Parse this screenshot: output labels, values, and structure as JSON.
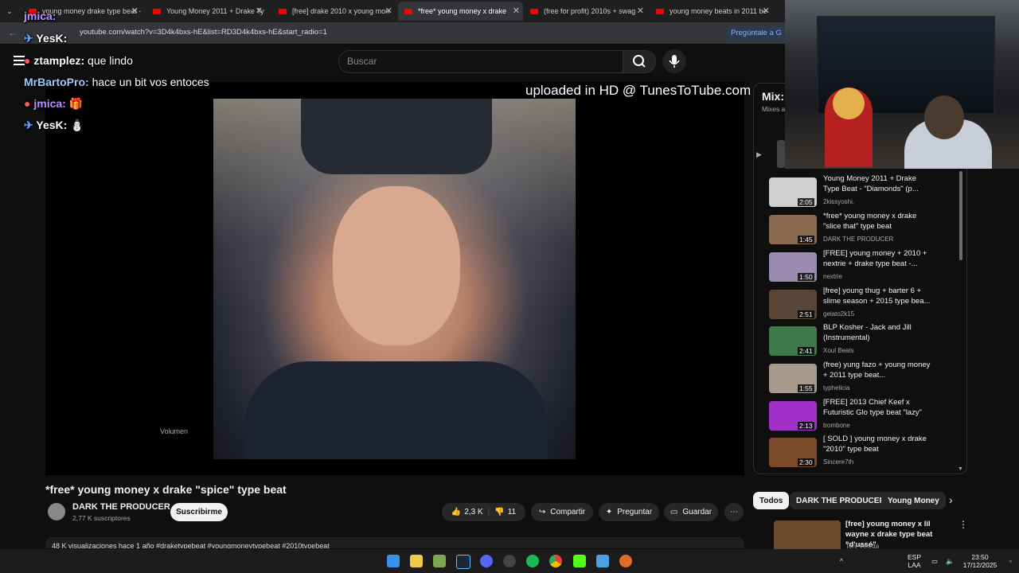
{
  "browser": {
    "tabs": [
      {
        "label": "young money drake type beat - Y"
      },
      {
        "label": "Young Money 2011 + Drake Ty"
      },
      {
        "label": "[free] drake 2010 x young mon"
      },
      {
        "label": "*free* young money x drake"
      },
      {
        "label": "(free for profit) 2010s + swag"
      },
      {
        "label": "young money beats in 2011 be"
      }
    ],
    "url": "youtube.com/watch?v=3D4k4bxs-hE&list=RD3D4k4bxs-hE&start_radio=1",
    "gemini": "Pregúntale a G"
  },
  "youtube": {
    "search_placeholder": "Buscar",
    "watermark": "uploaded in HD @ TunesToTube.com",
    "volume_label": "Volumen",
    "video_title": "*free* young money x drake \"spice\" type beat",
    "channel": "DARK THE PRODUCER",
    "subscribers": "2,77 K suscriptores",
    "subscribe": "Suscribirme",
    "likes": "2,3 K",
    "dislikes": "11",
    "share": "Compartir",
    "ask": "Preguntar",
    "save": "Guardar",
    "views_line": "48 K visualizaciones  hace 1 año  #draketypebeat #youngmoneytypebeat #2010typebeat",
    "mix_title": "Mix: *",
    "mix_sub": "Mixes ar",
    "playlist": [
      {
        "title": "Young Money 2011 + Drake Type Beat - \"Diamonds\" (p...",
        "channel": "2kissyoshi.",
        "duration": "2:05"
      },
      {
        "title": "*free* young money x drake \"slice that\" type beat",
        "channel": "DARK THE PRODUCER",
        "duration": "1:45"
      },
      {
        "title": "[FREE] young money + 2010 + nextrie + drake type beat -...",
        "channel": "nextrie",
        "duration": "1:50"
      },
      {
        "title": "[free] young thug + barter 6 + slime season + 2015 type bea...",
        "channel": "gelato2k15",
        "duration": "2:51"
      },
      {
        "title": "BLP Kosher - Jack and Jill (Instrumental)",
        "channel": "Xoul Beats",
        "duration": "2:41"
      },
      {
        "title": "(free) yung fazo + young money + 2011 type beat...",
        "channel": "typhelicia",
        "duration": "1:55"
      },
      {
        "title": "[FREE] 2013 Chief Keef x Futuristic Glo type beat \"lazy\"",
        "channel": "trombone",
        "duration": "2:13"
      },
      {
        "title": "[ SOLD ] young money x drake \"2010\" type beat",
        "channel": "Sincere7th",
        "duration": "2:30"
      }
    ],
    "chips": [
      "Todos",
      "DARK THE PRODUCER",
      "Young Money"
    ],
    "rec_title": "[free] young money x lil wayne x drake type beat \"d'ussé\"",
    "rec_channel": "Toni Veretta"
  },
  "chat": [
    {
      "user": "jmica:",
      "msg": ""
    },
    {
      "user": "YesK:",
      "msg": ""
    },
    {
      "user": "ztamplez:",
      "msg": "que lindo"
    },
    {
      "user": "MrBartoPro:",
      "msg": "hace un bit vos entoces"
    },
    {
      "user": "jmica:",
      "msg": ""
    },
    {
      "user": "YesK:",
      "msg": ""
    }
  ],
  "taskbar": {
    "lang_top": "ESP",
    "lang_bottom": "LAA",
    "time": "23:50",
    "date": "17/12/2025"
  },
  "colors": {
    "yt_red": "#ff0000",
    "bg": "#0f0f0f",
    "link_blue": "#8ab4f8"
  }
}
